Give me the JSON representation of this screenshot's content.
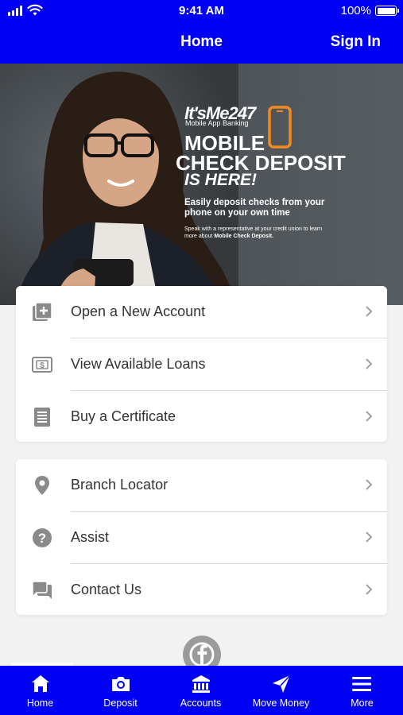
{
  "status": {
    "time": "9:41 AM",
    "battery": "100%"
  },
  "nav": {
    "title": "Home",
    "sign_in": "Sign In"
  },
  "banner": {
    "brand": "It'sMe247",
    "brand_sub": "Mobile App Banking",
    "headline_1": "MOBILE",
    "headline_2": "CHECK DEPOSIT",
    "headline_3": "IS HERE!",
    "description": "Easily deposit checks from your phone on your own time",
    "fine_print": "Speak with a representative at your credit union to learn more about",
    "fine_print_bold": "Mobile Check Deposit."
  },
  "menu_group_1": [
    {
      "label": "Open a New Account",
      "icon": "add-box-icon"
    },
    {
      "label": "View Available Loans",
      "icon": "dollar-bill-icon"
    },
    {
      "label": "Buy a Certificate",
      "icon": "certificate-icon"
    }
  ],
  "menu_group_2": [
    {
      "label": "Branch Locator",
      "icon": "location-pin-icon"
    },
    {
      "label": "Assist",
      "icon": "help-circle-icon"
    },
    {
      "label": "Contact Us",
      "icon": "chat-bubble-icon"
    }
  ],
  "social": {
    "icon": "facebook-icon"
  },
  "tabs": [
    {
      "label": "Home",
      "icon": "home-icon"
    },
    {
      "label": "Deposit",
      "icon": "camera-icon"
    },
    {
      "label": "Accounts",
      "icon": "bank-icon"
    },
    {
      "label": "Move Money",
      "icon": "send-icon"
    },
    {
      "label": "More",
      "icon": "menu-icon"
    }
  ],
  "colors": {
    "brand_blue": "#0000f5",
    "icon_gray": "#8a8a8a",
    "accent_orange": "#f28a1e"
  }
}
